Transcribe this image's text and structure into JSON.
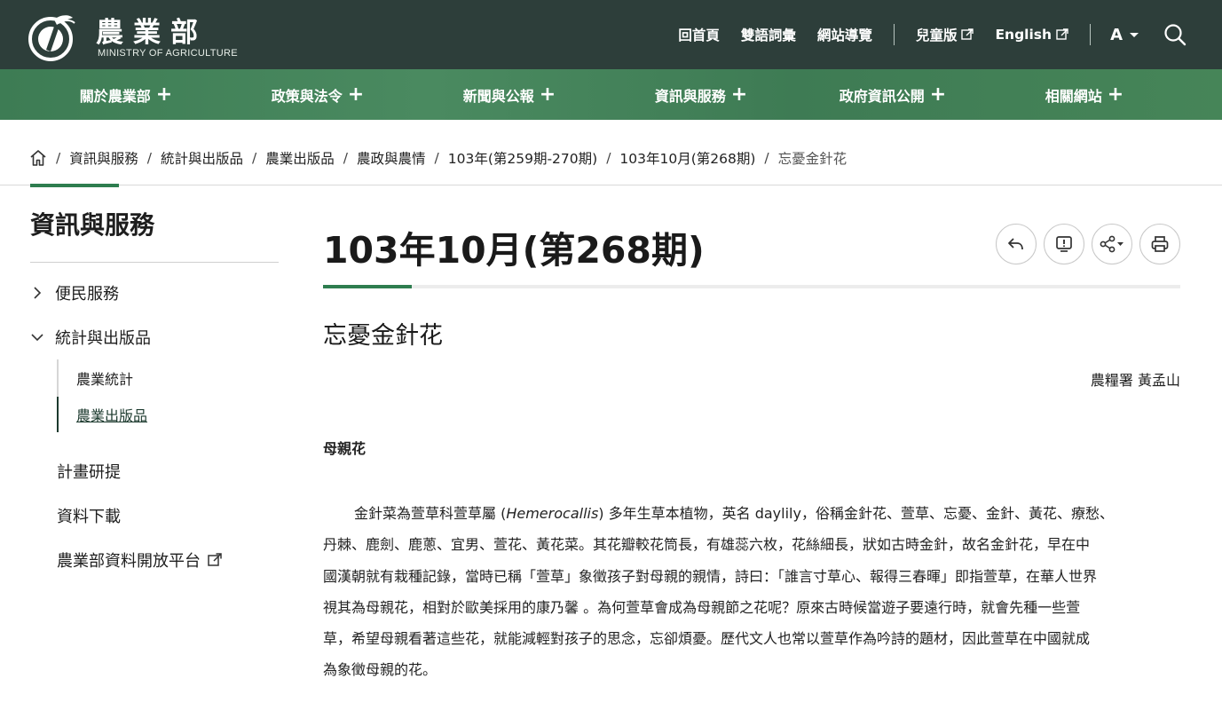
{
  "header": {
    "logo_title": "農業部",
    "logo_subtitle": "MINISTRY OF AGRICULTURE",
    "links": [
      "回首頁",
      "雙語詞彙",
      "網站導覽"
    ],
    "kids_label": "兒童版",
    "english_label": "English",
    "font_size_label": "A",
    "icons": {
      "external": "external-link-icon",
      "search": "search-icon",
      "caret": "caret-down-icon"
    },
    "colors": {
      "topbar": "#2d3e3a",
      "nav": "#3d7c54",
      "accent": "#2e7d4f"
    }
  },
  "nav": {
    "items": [
      "關於農業部",
      "政策與法令",
      "新聞與公報",
      "資訊與服務",
      "政府資訊公開",
      "相關網站"
    ],
    "expand_symbol": "+"
  },
  "breadcrumb": {
    "items": [
      "資訊與服務",
      "統計與出版品",
      "農業出版品",
      "農政與農情",
      "103年(第259期-270期)",
      "103年10月(第268期)",
      "忘憂金針花"
    ],
    "separator": "/"
  },
  "sidebar": {
    "title": "資訊與服務",
    "groups": [
      {
        "label": "便民服務",
        "expanded": false
      },
      {
        "label": "統計與出版品",
        "expanded": true,
        "children": [
          "農業統計",
          "農業出版品"
        ],
        "active_child": "農業出版品"
      }
    ],
    "items": [
      "計畫研提",
      "資料下載",
      "農業部資料開放平台"
    ]
  },
  "main": {
    "page_title": "103年10月(第268期)",
    "tools": [
      "back-icon",
      "feedback-icon",
      "share-icon",
      "print-icon"
    ],
    "article_title": "忘憂金針花",
    "author": "農糧署 黃孟山",
    "section_heading": "母親花",
    "body": {
      "l1_a": "金針菜為萱草科萱草屬 (",
      "l1_latin": "Hemerocallis",
      "l1_b": ") 多年生草本植物，英名 daylily，俗稱金針花、萱草、忘憂、金針、黃花、療愁、",
      "l2": "丹棘、鹿劍、鹿蔥、宜男、萱花、黃花菜。其花瓣較花筒長，有雄蕊六枚，花絲細長，狀如古時金針，故名金針花，早在中",
      "l3": "國漢朝就有栽種記錄，當時已稱「萱草」象徵孩子對母親的親情，詩曰：「誰言寸草心、報得三春暉」即指萱草，在華人世界",
      "l4": "視其為母親花，相對於歐美採用的康乃馨 。為何萱草會成為母親節之花呢？原來古時候當遊子要遠行時，就會先種一些萱",
      "l5": "草，希望母親看著這些花，就能減輕對孩子的思念，忘卻煩憂。歷代文人也常以萱草作為吟詩的題材，因此萱草在中國就成",
      "l6": "為象徵母親的花。"
    }
  }
}
